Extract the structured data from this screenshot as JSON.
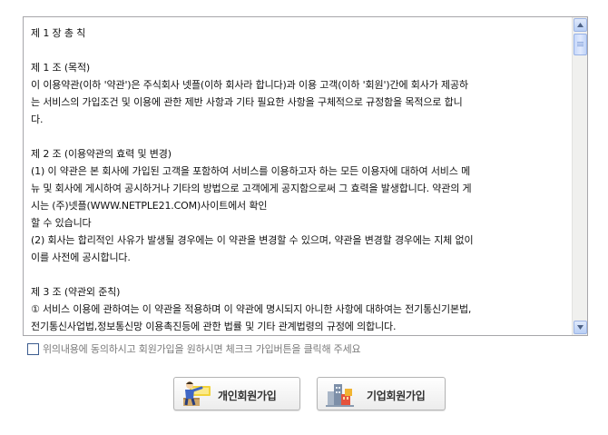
{
  "terms": {
    "chapter_title": "제 1 장 총 칙",
    "article1_title": "제 1 조 (목적)",
    "article1_body": "이 이용약관(이하 '약관')은 주식회사 넷플(이하 회사라 합니다)과 이용 고객(이하 '회원')간에 회사가 제공하\n는 서비스의 가입조건 및 이용에 관한 제반 사항과 기타 필요한 사항을 구체적으로 규정함을 목적으로 합니\n다.",
    "article2_title": "제 2 조 (이용약관의 효력 및 변경)",
    "article2_item1": "(1) 이 약관은 본 회사에 가입된 고객을 포함하여 서비스를 이용하고자 하는 모든 이용자에 대하여 서비스 메\n뉴 및 회사에 게시하여 공시하거나 기타의 방법으로 고객에게 공지함으로써 그 효력을 발생합니다. 약관의 게\n시는 (주)넷플(WWW.NETPLE21.COM)사이트에서 확인\n할 수 있습니다",
    "article2_item2": "(2) 회사는 합리적인 사유가 발생될 경우에는 이 약관을 변경할 수 있으며, 약관을 변경할 경우에는 지체 없이\n이를 사전에 공시합니다.",
    "article3_title": "제 3 조 (약관외 준칙)",
    "article3_body": "① 서비스 이용에 관하여는 이 약관을 적용하며 이 약관에 명시되지 아니한 사항에 대하여는 전기통신기본법,\n전기통신사업법,정보통신망 이용촉진등에 관한 법률 및 기타 관계법령의 규정에 의합니다."
  },
  "agree": {
    "label": "위의내용에 동의하시고 회원가입을 원하시면 체크크 가입버튼을 클릭해 주세요",
    "checked": false
  },
  "buttons": {
    "personal_label": "개인회원가입",
    "personal_icon": "person-icon",
    "company_label": "기업회원가입",
    "company_icon": "building-icon"
  },
  "colors": {
    "scroll_accent": "#b9cff5",
    "checkbox_border": "#3c5c8f"
  }
}
